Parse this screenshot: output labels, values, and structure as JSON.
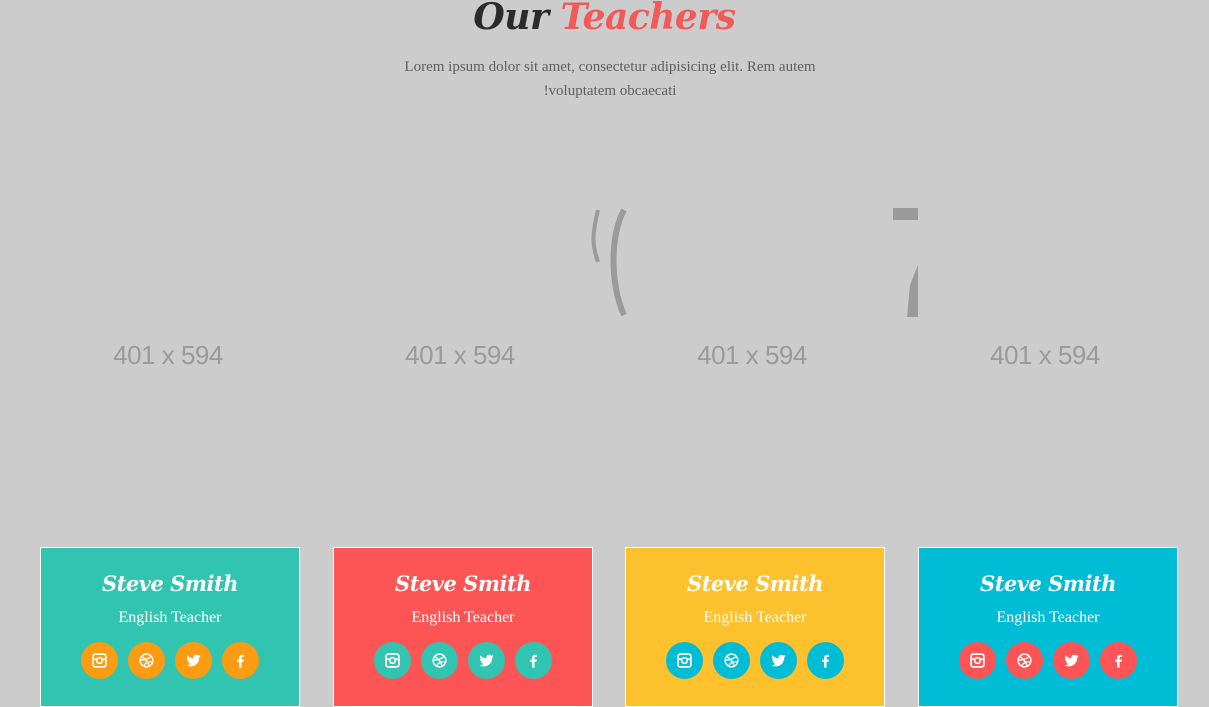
{
  "header": {
    "title_part1": "Our",
    "title_part2": "Teachers",
    "subtitle": "Lorem ipsum dolor sit amet, consectetur adipisicing elit. Rem autem !voluptatem obcaecati"
  },
  "colors": {
    "background": "#cccccc",
    "title_dark": "#2b2b2b",
    "title_accent": "#f25a5a",
    "teal": "#31c4b0",
    "red": "#fd5555",
    "yellow": "#fdc12e",
    "cyan": "#00bcd4",
    "orange": "#fb9c12"
  },
  "teachers": [
    {
      "image_placeholder": "401 x 594",
      "name": "Steve Smith",
      "role": "English Teacher",
      "card_color": "#31c4b0",
      "icon_color": "#fb9c12"
    },
    {
      "image_placeholder": "401 x 594",
      "name": "Steve Smith",
      "role": "English Teacher",
      "card_color": "#fd5555",
      "icon_color": "#31c4b0"
    },
    {
      "image_placeholder": "401 x 594",
      "name": "Steve Smith",
      "role": "English Teacher",
      "card_color": "#fdc12e",
      "icon_color": "#00bcd4"
    },
    {
      "image_placeholder": "401 x 594",
      "name": "Steve Smith",
      "role": "English Teacher",
      "card_color": "#00bcd4",
      "icon_color": "#fd5555"
    }
  ],
  "social_icons": [
    "instagram-icon",
    "dribbble-icon",
    "twitter-icon",
    "facebook-icon"
  ]
}
